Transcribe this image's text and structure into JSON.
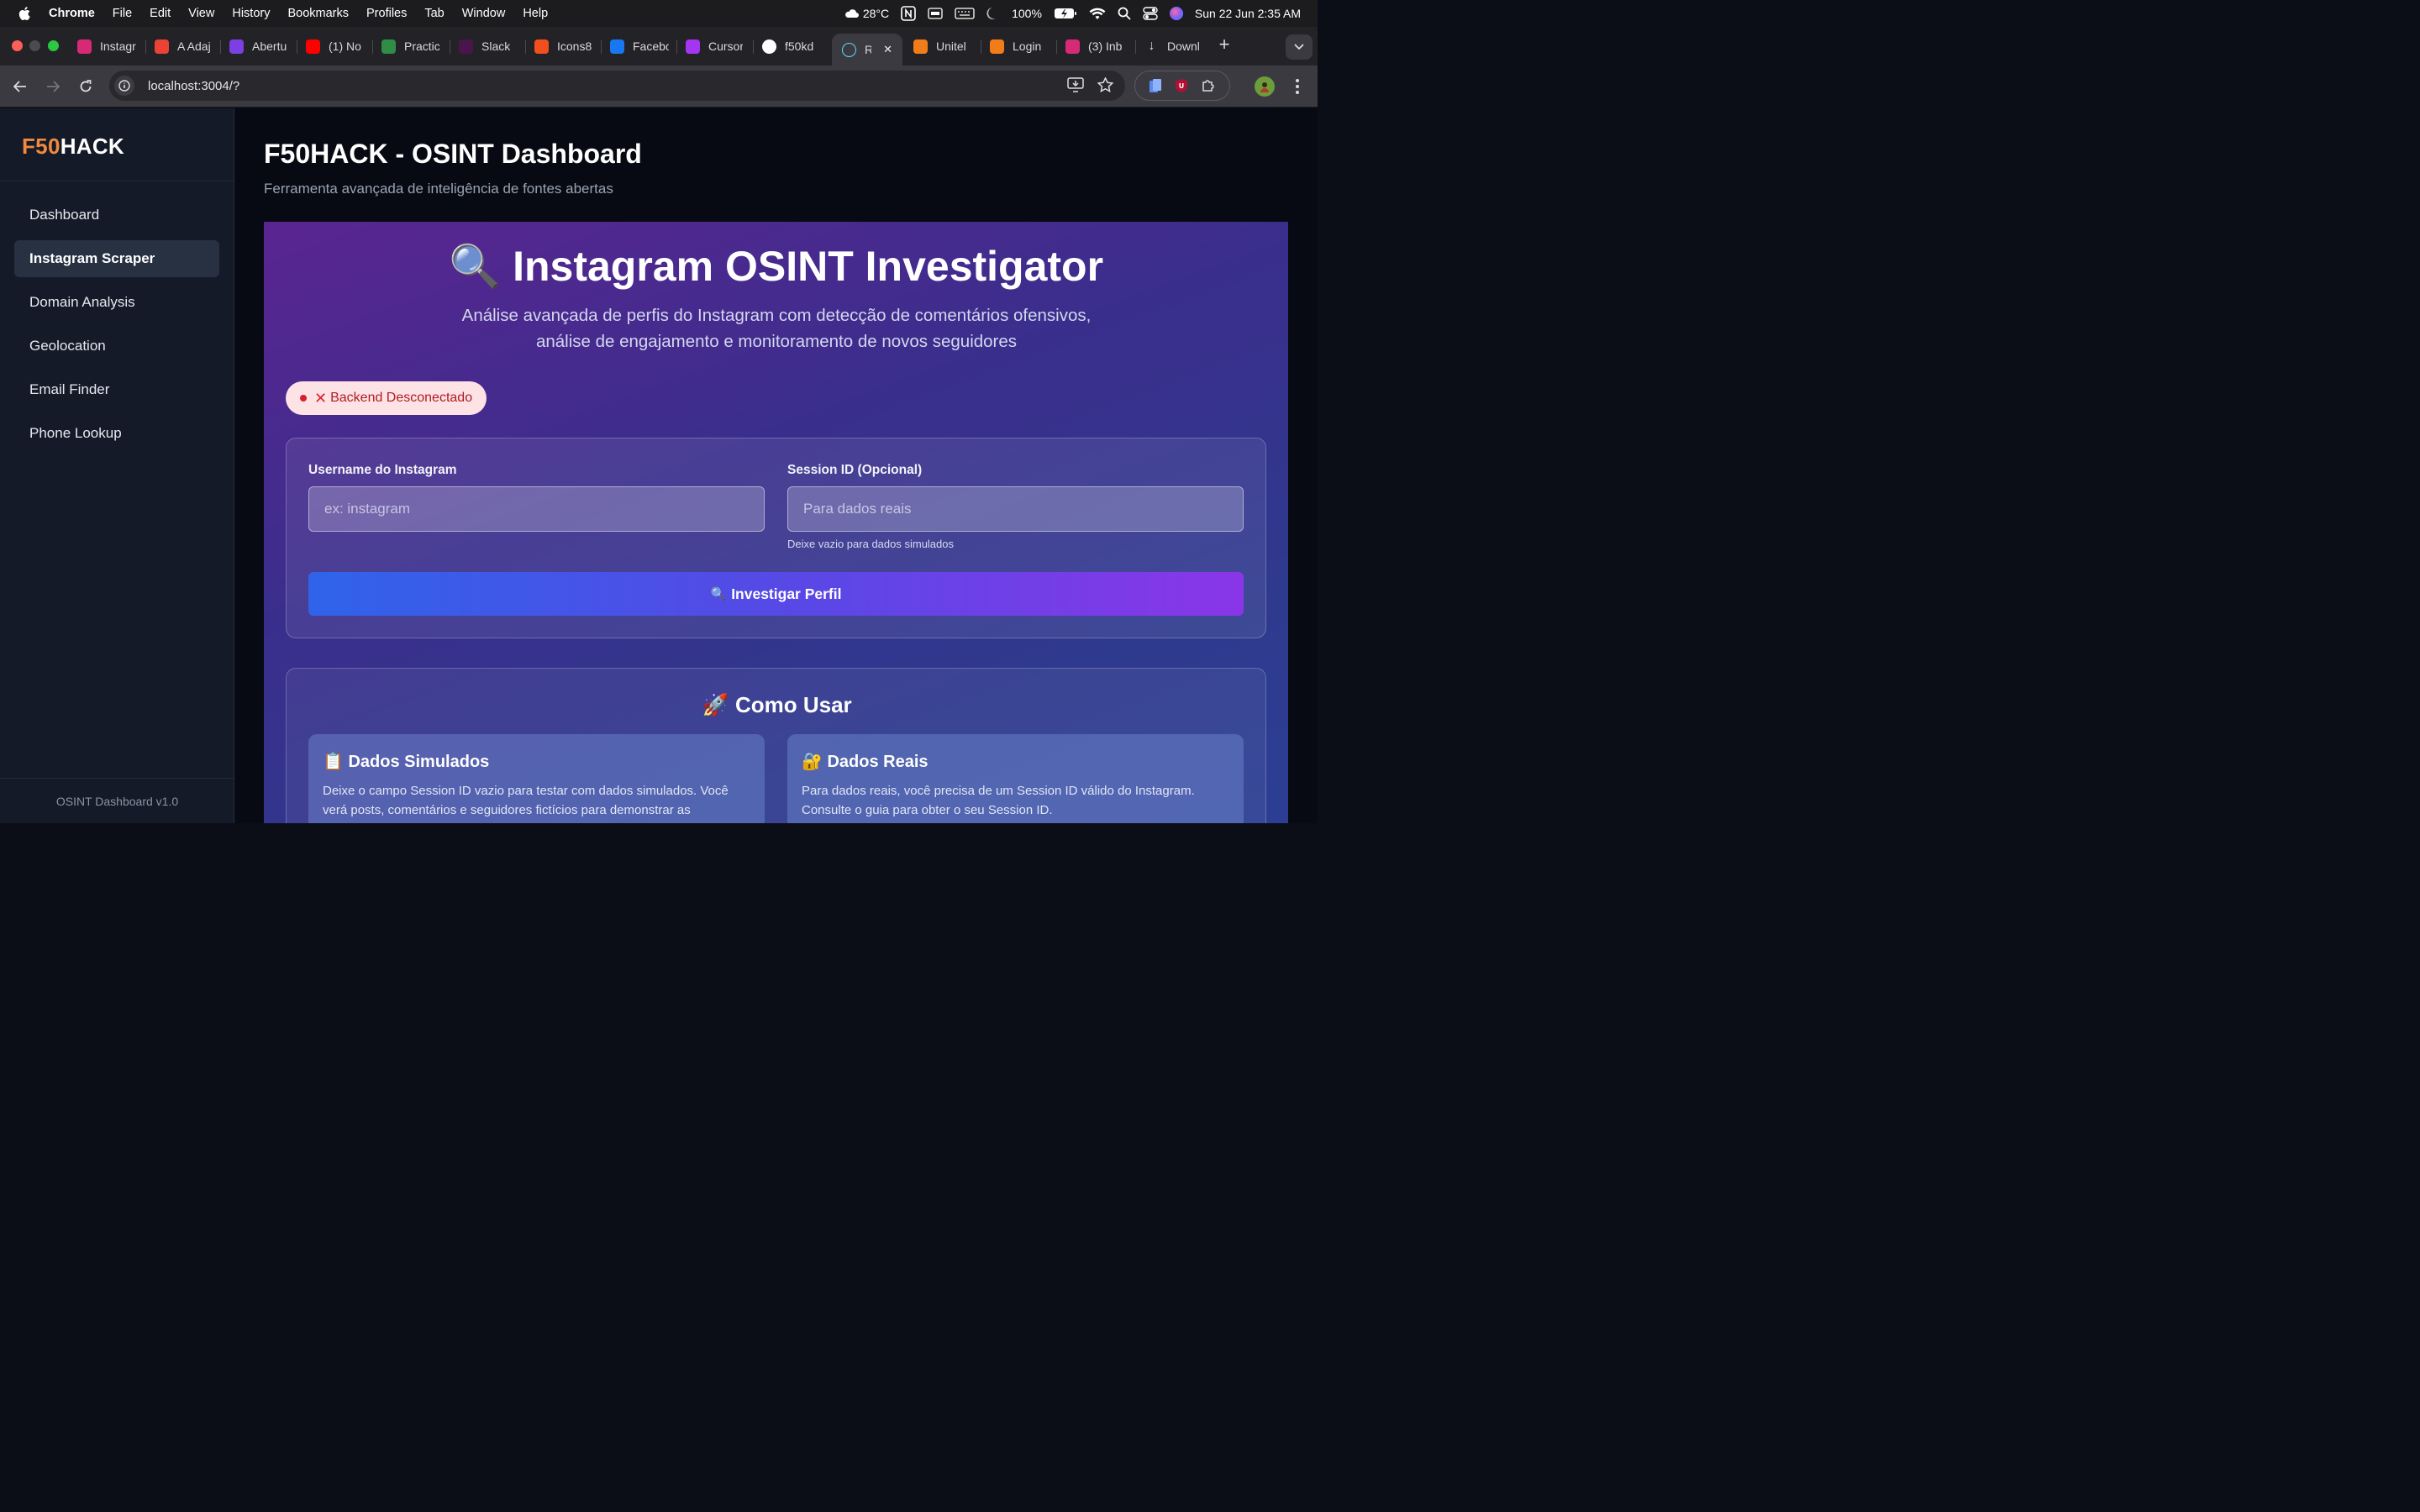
{
  "menubar": {
    "app_name": "Chrome",
    "items": [
      "File",
      "Edit",
      "View",
      "History",
      "Bookmarks",
      "Profiles",
      "Tab",
      "Window",
      "Help"
    ],
    "weather": "28°C",
    "battery": "100%",
    "datetime": "Sun 22 Jun  2:35 AM"
  },
  "browser": {
    "tabs": [
      {
        "title": "Instagr",
        "icon": "instagram-icon",
        "color": "#d62976"
      },
      {
        "title": "A Adaj",
        "icon": "gmail-icon",
        "color": "#ea4335"
      },
      {
        "title": "Abertu",
        "icon": "app-icon",
        "color": "#7b3fe4"
      },
      {
        "title": "(1) No",
        "icon": "youtube-icon",
        "color": "#ff0000"
      },
      {
        "title": "Practic",
        "icon": "gfg-icon",
        "color": "#2f8d46"
      },
      {
        "title": "Slack",
        "icon": "slack-icon",
        "color": "#4a154b"
      },
      {
        "title": "Icons8",
        "icon": "figma-icon",
        "color": "#f24e1e"
      },
      {
        "title": "Facebo",
        "icon": "facebook-icon",
        "color": "#1877f2"
      },
      {
        "title": "Cursor",
        "icon": "udemy-icon",
        "color": "#a435f0"
      },
      {
        "title": "f50kd",
        "icon": "github-icon",
        "color": "#ffffff"
      },
      {
        "title": "Re",
        "icon": "react-icon",
        "color": "#61dafb"
      },
      {
        "title": "Unitel",
        "icon": "unitel-icon",
        "color": "#f07d1a"
      },
      {
        "title": "Login",
        "icon": "unitel-icon",
        "color": "#f07d1a"
      },
      {
        "title": "(3) Inb",
        "icon": "instagram-icon",
        "color": "#d62976"
      },
      {
        "title": "Downl",
        "icon": "download-icon",
        "color": "#cccccc"
      }
    ],
    "url": "localhost:3004/?"
  },
  "sidebar": {
    "brand_accent": "F50",
    "brand_rest": "HACK",
    "items": [
      {
        "label": "Dashboard",
        "active": false
      },
      {
        "label": "Instagram Scraper",
        "active": true
      },
      {
        "label": "Domain Analysis",
        "active": false
      },
      {
        "label": "Geolocation",
        "active": false
      },
      {
        "label": "Email Finder",
        "active": false
      },
      {
        "label": "Phone Lookup",
        "active": false
      }
    ],
    "version": "OSINT Dashboard v1.0"
  },
  "main": {
    "title": "F50HACK - OSINT Dashboard",
    "subtitle": "Ferramenta avançada de inteligência de fontes abertas",
    "hero": {
      "title": "Instagram OSINT Investigator",
      "desc_line1": "Análise avançada de perfis do Instagram com detecção de comentários ofensivos,",
      "desc_line2": "análise de engajamento e monitoramento de novos seguidores"
    },
    "status": "Backend Desconectado",
    "form": {
      "username_label": "Username do Instagram",
      "username_placeholder": "ex: instagram",
      "username_value": "",
      "session_label": "Session ID (Opcional)",
      "session_placeholder": "Para dados reais",
      "session_value": "",
      "session_hint": "Deixe vazio para dados simulados",
      "submit_label": "Investigar Perfil"
    },
    "howto": {
      "title": "Como Usar",
      "cards": [
        {
          "title": "Dados Simulados",
          "text": "Deixe o campo Session ID vazio para testar com dados simulados. Você verá posts, comentários e seguidores fictícios para demonstrar as"
        },
        {
          "title": "Dados Reais",
          "text": "Para dados reais, você precisa de um Session ID válido do Instagram. Consulte o guia para obter o seu Session ID."
        }
      ]
    }
  },
  "colors": {
    "brand_accent": "#f08a3c",
    "sidebar_bg": "#141a28",
    "status_error": "#d81f2c",
    "button_gradient_start": "#2f63ea",
    "button_gradient_end": "#8a36e8"
  }
}
